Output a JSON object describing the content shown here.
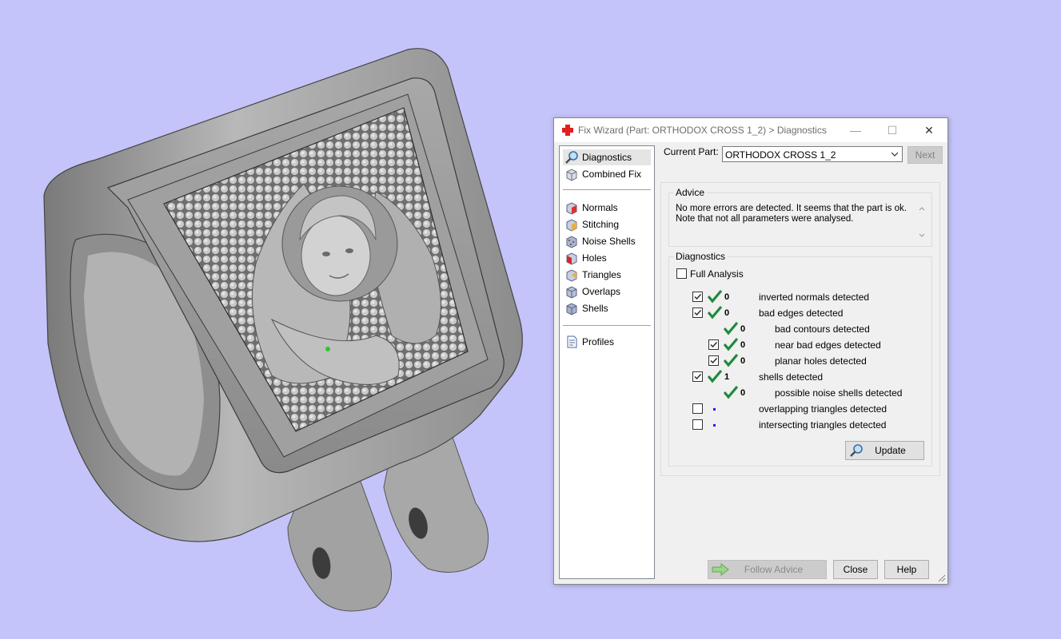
{
  "window": {
    "title": "Fix Wizard (Part: ORTHODOX CROSS 1_2) > Diagnostics",
    "minimize": "—",
    "maximize": "☐",
    "close": "✕"
  },
  "nav": {
    "top_items": [
      {
        "label": "Diagnostics",
        "icon": "magnifier-icon",
        "selected": true
      },
      {
        "label": "Combined Fix",
        "icon": "cube-stack-icon"
      }
    ],
    "fix_items": [
      {
        "label": "Normals",
        "icon": "normals-cube-icon"
      },
      {
        "label": "Stitching",
        "icon": "stitching-cube-icon"
      },
      {
        "label": "Noise Shells",
        "icon": "noise-shells-icon"
      },
      {
        "label": "Holes",
        "icon": "holes-cube-icon"
      },
      {
        "label": "Triangles",
        "icon": "triangles-cube-icon"
      },
      {
        "label": "Overlaps",
        "icon": "overlaps-cube-icon"
      },
      {
        "label": "Shells",
        "icon": "shells-cube-icon"
      }
    ],
    "profiles": {
      "label": "Profiles",
      "icon": "document-icon"
    }
  },
  "current_part": {
    "label": "Current Part:",
    "value": "ORTHODOX CROSS 1_2"
  },
  "next_button": "Next",
  "advice": {
    "title": "Advice",
    "line1": "No more errors are detected. It seems that the part is ok.",
    "line2": "Note that not all parameters were analysed."
  },
  "diagnostics": {
    "title": "Diagnostics",
    "full_analysis": {
      "label": "Full Analysis",
      "checked": false
    },
    "rows": [
      {
        "checkbox": true,
        "checked": true,
        "status": "ok",
        "count": "0",
        "label": "inverted normals detected",
        "indent": 0
      },
      {
        "checkbox": true,
        "checked": true,
        "status": "ok",
        "count": "0",
        "label": "bad edges detected",
        "indent": 0
      },
      {
        "checkbox": false,
        "checked": false,
        "status": "ok",
        "count": "0",
        "label": "bad contours detected",
        "indent": 1
      },
      {
        "checkbox": true,
        "checked": true,
        "status": "ok",
        "count": "0",
        "label": "near bad edges detected",
        "indent": 1
      },
      {
        "checkbox": true,
        "checked": true,
        "status": "ok",
        "count": "0",
        "label": "planar holes detected",
        "indent": 1
      },
      {
        "checkbox": true,
        "checked": true,
        "status": "ok",
        "count": "1",
        "label": "shells detected",
        "indent": 0
      },
      {
        "checkbox": false,
        "checked": false,
        "status": "ok",
        "count": "0",
        "label": "possible noise shells detected",
        "indent": 1
      },
      {
        "checkbox": true,
        "checked": false,
        "status": "dot",
        "count": "",
        "label": "overlapping triangles detected",
        "indent": 0
      },
      {
        "checkbox": true,
        "checked": false,
        "status": "dot",
        "count": "",
        "label": "intersecting triangles detected",
        "indent": 0
      }
    ],
    "update_button": "Update"
  },
  "footer": {
    "follow_advice": "Follow Advice",
    "close": "Close",
    "help": "Help"
  },
  "colors": {
    "background": "#c4c4fa",
    "check_green": "#1f8a3c",
    "model_gray": "#9a9a9a"
  }
}
